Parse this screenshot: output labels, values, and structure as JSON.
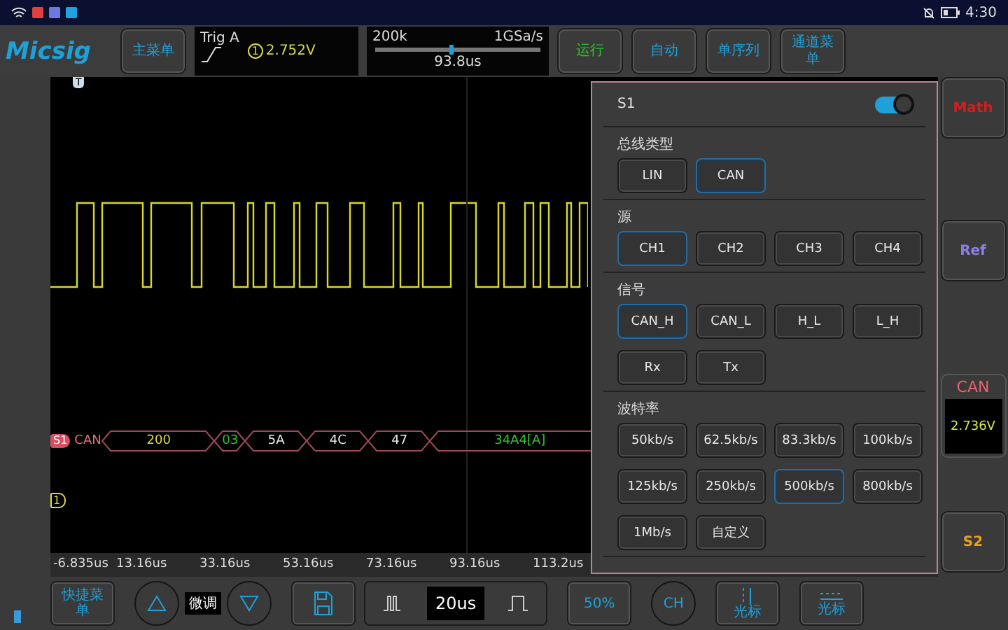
{
  "status_bar": {
    "time": "4:30"
  },
  "toolbar": {
    "logo": "Micsig",
    "main_menu": "主菜单",
    "trigger": {
      "title": "Trig A",
      "channel": "1",
      "level": "2.752V"
    },
    "timebase": {
      "memory": "200k",
      "sample_rate": "1GSa/s",
      "delay": "93.8us",
      "level": 0.45
    },
    "buttons": [
      {
        "label": "运行",
        "color": "#2fc12f"
      },
      {
        "label": "自动",
        "color": "#1fa0d8"
      },
      {
        "label": "单序列",
        "color": "#1fa0d8"
      },
      {
        "label": "通道菜单",
        "color": "#1fa0d8"
      }
    ]
  },
  "scope": {
    "trigger_marker": "T",
    "decode": {
      "marker": "S1",
      "label": "CAN",
      "packets": [
        {
          "text": "200",
          "color": "#d8d84a"
        },
        {
          "text": "03",
          "color": "#2fc12f"
        },
        {
          "text": "5A",
          "color": "#e8e8e8"
        },
        {
          "text": "4C",
          "color": "#e8e8e8"
        },
        {
          "text": "47",
          "color": "#e8e8e8"
        },
        {
          "text": "34A4[A]",
          "color": "#2fc12f"
        }
      ]
    },
    "channel_marker": "1",
    "time_labels": [
      "-6.835us",
      "13.16us",
      "33.16us",
      "53.16us",
      "73.16us",
      "93.16us",
      "113.2us"
    ]
  },
  "panel": {
    "title": "S1",
    "on": true,
    "sections": [
      {
        "title": "总线类型",
        "options": [
          {
            "label": "LIN",
            "selected": false
          },
          {
            "label": "CAN",
            "selected": true
          }
        ]
      },
      {
        "title": "源",
        "options": [
          {
            "label": "CH1",
            "selected": true
          },
          {
            "label": "CH2",
            "selected": false
          },
          {
            "label": "CH3",
            "selected": false
          },
          {
            "label": "CH4",
            "selected": false
          }
        ]
      },
      {
        "title": "信号",
        "options": [
          {
            "label": "CAN_H",
            "selected": true
          },
          {
            "label": "CAN_L",
            "selected": false
          },
          {
            "label": "H_L",
            "selected": false
          },
          {
            "label": "L_H",
            "selected": false
          },
          {
            "label": "Rx",
            "selected": false
          },
          {
            "label": "Tx",
            "selected": false
          }
        ]
      },
      {
        "title": "波特率",
        "options": [
          {
            "label": "50kb/s",
            "selected": false
          },
          {
            "label": "62.5kb/s",
            "selected": false
          },
          {
            "label": "83.3kb/s",
            "selected": false
          },
          {
            "label": "100kb/s",
            "selected": false
          },
          {
            "label": "125kb/s",
            "selected": false
          },
          {
            "label": "250kb/s",
            "selected": false
          },
          {
            "label": "500kb/s",
            "selected": true
          },
          {
            "label": "800kb/s",
            "selected": false
          },
          {
            "label": "1Mb/s",
            "selected": false
          },
          {
            "label": "自定义",
            "selected": false
          }
        ]
      }
    ]
  },
  "side_buttons": [
    {
      "kind": "button",
      "label": "Math",
      "color": "#d02020"
    },
    {
      "kind": "button",
      "label": "Ref",
      "color": "#8a80e8"
    },
    {
      "kind": "readout",
      "label": "CAN",
      "value": "2.736V",
      "color": "#e86070"
    },
    {
      "kind": "button",
      "label": "S2",
      "color": "#e8a020"
    }
  ],
  "bottom_bar": {
    "quick_menu": "快捷菜单",
    "fine_tune": "微调",
    "timebase": "20us",
    "fifty": "50%",
    "channel": "CH",
    "cursor_vertical": "光标",
    "cursor_horizontal": "光标"
  }
}
